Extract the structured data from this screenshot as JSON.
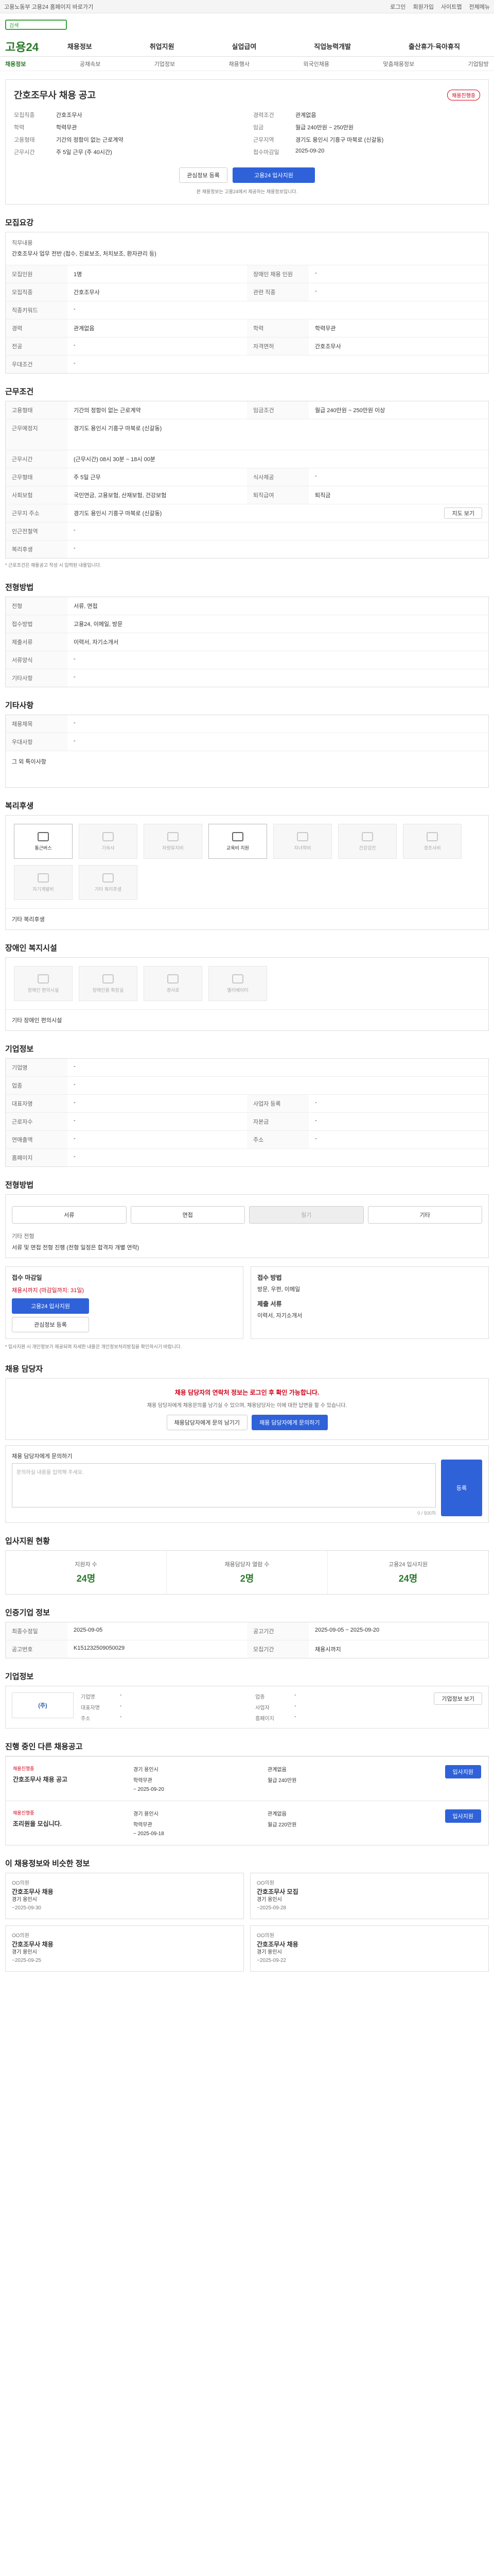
{
  "topbar": {
    "left": "고용노동부 고용24 홈페이지 바로가기",
    "right": [
      "로그인",
      "회원가입",
      "사이트맵",
      "전체메뉴"
    ]
  },
  "search": {
    "placeholder": "검색"
  },
  "logo": "고용24",
  "gnb": [
    "채용정보",
    "취업지원",
    "실업급여",
    "직업능력개발",
    "출산휴가·육아휴직"
  ],
  "subnav": [
    "채용정보",
    "공채속보",
    "기업정보",
    "채용행사",
    "외국인채용",
    "맞춤채용정보",
    "기업탐방"
  ],
  "job": {
    "title": "간호조무사 채용 공고",
    "status": "채용진행중",
    "recruit_type_k": "모집직종",
    "recruit_type_v": "간호조무사",
    "career_k": "경력조건",
    "career_v": "관계없음",
    "edu_k": "학력",
    "edu_v": "학력무관",
    "wage_k": "임금",
    "wage_v": "월급 240만원 ~ 250만원",
    "area_k": "근무지역",
    "area_v": "경기도 용인시 기흥구 마북로 (신갈동)",
    "worktype_k": "고용형태",
    "worktype_v": "기간의 정함이 없는 근로계약",
    "time_k": "근무시간",
    "time_v": "주 5일 근무 (주 40시간)",
    "deadline_k": "접수마감일",
    "deadline_v": "2025-09-20",
    "apply_btn": "고용24 입사지원",
    "scrap_btn": "관심정보 등록",
    "note": "본 채용정보는 고용24에서 제공하는 채용정보입니다."
  },
  "sec_recruit": "모집요강",
  "recruit": {
    "job_k": "직무내용",
    "job_v": "간호조무사 업무 전반 (접수, 진료보조, 처치보조, 환자관리 등)",
    "rows": [
      {
        "k": "모집인원",
        "v": "1명",
        "k2": "장애인 채용 인원",
        "v2": "-"
      },
      {
        "k": "모집직종",
        "v": "간호조무사",
        "k2": "관련 직종",
        "v2": "-"
      },
      {
        "k": "직종키워드",
        "v": "-",
        "k2": "",
        "v2": ""
      },
      {
        "k": "경력",
        "v": "관계없음",
        "k2": "학력",
        "v2": "학력무관"
      },
      {
        "k": "전공",
        "v": "-",
        "k2": "자격면허",
        "v2": "간호조무사"
      },
      {
        "k": "우대조건",
        "v": "-",
        "k2": "",
        "v2": ""
      }
    ]
  },
  "sec_cond": "근무조건",
  "cond": {
    "rows": [
      {
        "k": "고용형태",
        "v": "기간의 정함이 없는 근로계약",
        "k2": "임금조건",
        "v2": "월급 240만원 ~ 250만원 이상"
      },
      {
        "k": "근무예정지",
        "v": "경기도 용인시 기흥구 마북로 (신갈동)",
        "k2": "",
        "v2": ""
      },
      {
        "k": "근무시간",
        "v": "(근무시간) 08시 30분 ~ 18시 00분",
        "k2": "",
        "v2": ""
      },
      {
        "k": "근무형태",
        "v": "주 5일 근무",
        "k2": "식사제공",
        "v2": "-"
      },
      {
        "k": "사회보험",
        "v": "국민연금, 고용보험, 산재보험, 건강보험",
        "k2": "퇴직급여",
        "v2": "퇴직금"
      },
      {
        "k": "근무지 주소",
        "v": "경기도 용인시 기흥구 마북로 (신갈동)",
        "k2": "",
        "v2": ""
      },
      {
        "k": "인근전철역",
        "v": "-",
        "k2": "",
        "v2": ""
      },
      {
        "k": "복리후생",
        "v": "-",
        "k2": "",
        "v2": ""
      }
    ],
    "map_btn": "지도 보기",
    "note": "* 근로조건은 채용공고 작성 시 입력된 내용입니다."
  },
  "sec_select": "전형방법",
  "select": {
    "rows": [
      {
        "k": "전형",
        "v": "서류, 면접"
      },
      {
        "k": "접수방법",
        "v": "고용24, 이메일, 방문"
      },
      {
        "k": "제출서류",
        "v": "이력서, 자기소개서"
      },
      {
        "k": "서류양식",
        "v": "-"
      },
      {
        "k": "기타사항",
        "v": "-"
      }
    ]
  },
  "sec_etc": "기타사항",
  "etc": {
    "rows": [
      {
        "k": "채용제목",
        "v": "-"
      },
      {
        "k": "우대사항",
        "v": "-"
      }
    ],
    "text": "그 외 특이사항"
  },
  "sec_welfare": "복리후생",
  "welfare": {
    "tiles": [
      "통근버스",
      "기숙사",
      "차량유지비",
      "교육비 지원",
      "자녀학비",
      "건강검진",
      "경조사비",
      "자기계발비",
      "기타 복리후생"
    ],
    "note": "기타 복리후생"
  },
  "sec_disabled": "장애인 복지시설",
  "disabled": {
    "tiles": [
      "장애인 편의시설",
      "장애인용 화장실",
      "경사로",
      "엘리베이터"
    ],
    "note": "기타 장애인 편의시설"
  },
  "sec_company": "기업정보",
  "company": {
    "rows": [
      {
        "k": "기업명",
        "v": "-",
        "k2": "",
        "v2": ""
      },
      {
        "k": "업종",
        "v": "-",
        "k2": "",
        "v2": ""
      },
      {
        "k": "대표자명",
        "v": "-",
        "k2": "사업자 등록",
        "v2": "-"
      },
      {
        "k": "근로자수",
        "v": "-",
        "k2": "자본금",
        "v2": "-"
      },
      {
        "k": "연매출액",
        "v": "-",
        "k2": "주소",
        "v2": "-"
      },
      {
        "k": "홈페이지",
        "v": "-",
        "k2": "",
        "v2": ""
      }
    ]
  },
  "sec_process": "전형방법",
  "process": {
    "seg": [
      "서류",
      "면접",
      "필기",
      "기타"
    ],
    "seg_note": "기타 전형",
    "seg_text": "서류 및 면접 전형 진행 (전형 일정은 합격자 개별 연락)"
  },
  "apply_card": {
    "h": "접수 마감일",
    "deadline": "채용시까지 (마감일까지: 31일)",
    "a_btn": "고용24 입사지원",
    "b_btn": "관심정보 등록",
    "h2": "접수 방법",
    "how": "방문, 우편, 이메일",
    "h3": "제출 서류",
    "docs": "이력서, 자기소개서"
  },
  "apply_notes": "* 입사지원 시 개인정보가 제공되며 자세한 내용은 개인정보처리방침을 확인하시기 바랍니다.",
  "sec_contact": "채용 담당자",
  "contact": {
    "warn": "채용 담당자의 연락처 정보는 로그인 후 확인 가능합니다.",
    "sub": "채용 담당자에게 채용문의를 남기실 수 있으며, 채용담당자는 이에 대한 답변을 할 수 있습니다.",
    "login_btn": "채용담당자에게 문의 남기기",
    "ask_btn": "채용 담당자에게 문의하기",
    "msg_label": "채용 담당자에게 문의하기",
    "msg_placeholder": "문의하실 내용을 입력해 주세요.",
    "submit": "등록",
    "counter": "0 / 500자"
  },
  "sec_stats": "입사지원 현황",
  "stats": [
    {
      "k": "지원자 수",
      "v": "24명"
    },
    {
      "k": "채용담당자 열람 수",
      "v": "2명"
    },
    {
      "k": "고용24 입사지원",
      "v": "24명"
    }
  ],
  "sec_info": "인증기업 정보",
  "info": {
    "rows": [
      {
        "k": "최종수정일",
        "v": "2025-09-05",
        "k2": "공고기간",
        "v2": "2025-09-05 ~ 2025-09-20"
      },
      {
        "k": "공고번호",
        "v": "K151232509050029",
        "k2": "모집기간",
        "v2": "채용시까지"
      }
    ]
  },
  "sec_corp": "기업정보",
  "corp": {
    "name": "(주)",
    "rows": [
      {
        "k": "기업명",
        "v": "-",
        "k2": "업종",
        "v2": "-"
      },
      {
        "k": "대표자명",
        "v": "-",
        "k2": "사업자",
        "v2": "-"
      },
      {
        "k": "주소",
        "v": "-",
        "k2": "홈페이지",
        "v2": "-"
      }
    ],
    "btn": "기업정보 보기"
  },
  "sec_jobs": "진행 중인 다른 채용공고",
  "jobs": [
    {
      "tag": "채용진행중",
      "title": "간호조무사 채용 공고",
      "area": "경기 용인시",
      "career": "관계없음",
      "edu": "학력무관",
      "wage": "월급 240만원",
      "date": "~ 2025-09-20",
      "btn": "입사지원"
    },
    {
      "tag": "채용진행중",
      "title": "조리원을 모십니다.",
      "area": "경기 용인시",
      "career": "관계없음",
      "edu": "학력무관",
      "wage": "월급 220만원",
      "date": "~ 2025-09-18",
      "btn": "입사지원"
    }
  ],
  "sec_similar": "이 채용정보와 비슷한 정보",
  "similar": [
    {
      "title": "간호조무사 채용",
      "co": "OO의원",
      "area": "경기 용인시",
      "date": "~2025-09-30"
    },
    {
      "title": "간호조무사 모집",
      "co": "OO의원",
      "area": "경기 용인시",
      "date": "~2025-09-28"
    },
    {
      "title": "간호조무사 채용",
      "co": "OO의원",
      "area": "경기 용인시",
      "date": "~2025-09-25"
    },
    {
      "title": "간호조무사 채용",
      "co": "OO의원",
      "area": "경기 용인시",
      "date": "~2025-09-22"
    }
  ]
}
